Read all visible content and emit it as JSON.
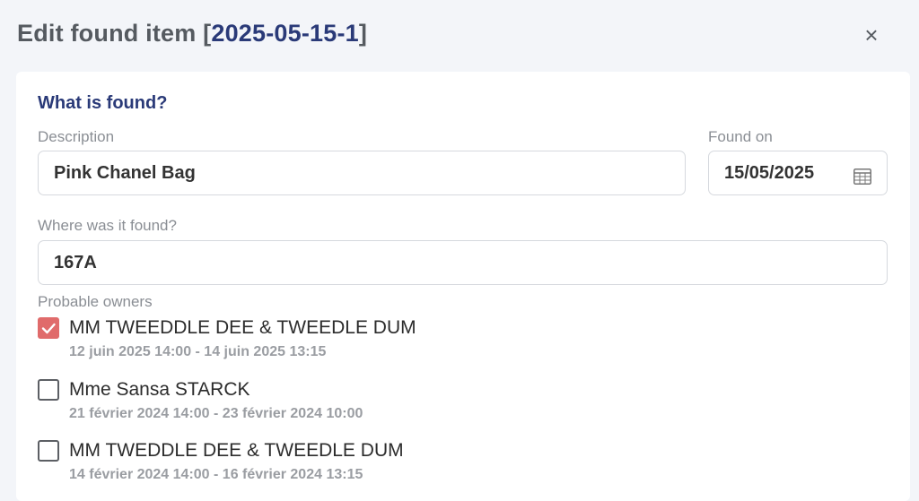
{
  "dialog": {
    "title_prefix": "Edit found item [",
    "title_ref": "2025-05-15-1",
    "title_suffix": "]",
    "close_label": "×"
  },
  "form": {
    "section_title": "What is found?",
    "description": {
      "label": "Description",
      "value": "Pink Chanel Bag"
    },
    "found_on": {
      "label": "Found on",
      "value": "15/05/2025"
    },
    "location": {
      "label": "Where was it found?",
      "value": "167A"
    },
    "owners_label": "Probable owners",
    "owners": [
      {
        "name": "MM TWEEDDLE DEE & TWEEDLE DUM",
        "dates": "12 juin 2025 14:00 - 14 juin 2025 13:15",
        "checked": true
      },
      {
        "name": "Mme Sansa STARCK",
        "dates": "21 février 2024 14:00 - 23 février 2024 10:00",
        "checked": false
      },
      {
        "name": "MM TWEDDLE DEE & TWEEDLE DUM",
        "dates": "14 février 2024 14:00 - 16 février 2024 13:15",
        "checked": false
      }
    ]
  },
  "colors": {
    "accent": "#2a3a78",
    "checkbox_checked": "#e06b6b"
  }
}
